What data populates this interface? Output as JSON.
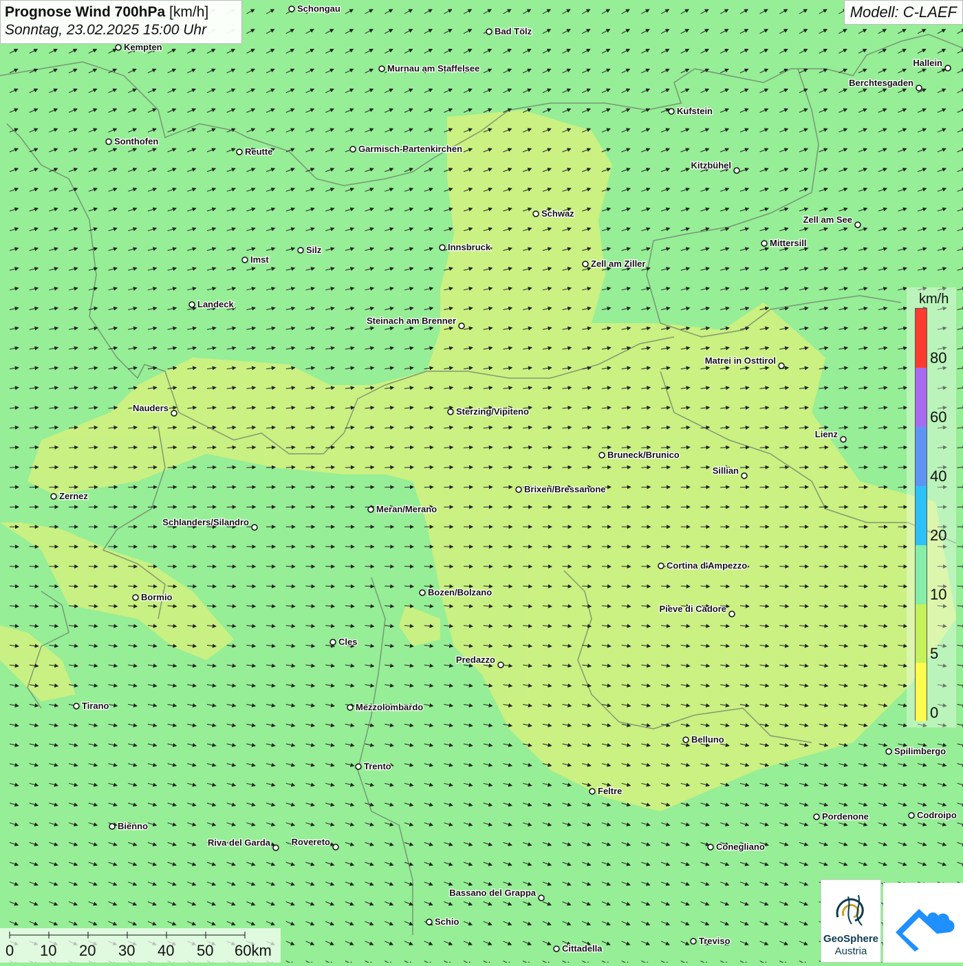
{
  "title": {
    "bold": "Prognose Wind 700hPa",
    "unit": "[km/h]",
    "date": "Sonntag, 23.02.2025 15:00 Uhr"
  },
  "model": "Modell: C-LAEF",
  "legend": {
    "unit": "km/h",
    "labels": [
      "80",
      "60",
      "40",
      "20",
      "10",
      "5",
      "0"
    ],
    "colors": [
      "#ff3b30",
      "#a86bf0",
      "#5e95f5",
      "#2ec1f7",
      "#86eea8",
      "#c5f15b",
      "#fffb4f"
    ]
  },
  "scale": {
    "labels": [
      "0",
      "10",
      "20",
      "30",
      "40",
      "50",
      "60km"
    ]
  },
  "logos": {
    "geosphere_line1": "GeoSphere",
    "geosphere_line2": "Austria"
  },
  "cities": [
    "Schongau",
    "Bad Tölz",
    "Kempten",
    "Murnau am Staffelsee",
    "Hallein",
    "Berchtesgaden",
    "Kufstein",
    "Sonthofen",
    "Reutte",
    "Garmisch-Partenkirchen",
    "Kitzbühel",
    "Schwaz",
    "Zell am See",
    "Innsbruck",
    "Mittersill",
    "Silz",
    "Imst",
    "Zell am Ziller",
    "Landeck",
    "Steinach am Brenner",
    "Matrei in Osttirol",
    "Nauders",
    "Sterzing/Vipiteno",
    "Lienz",
    "Bruneck/Brunico",
    "Sillian",
    "Zernez",
    "Brixen/Bressanone",
    "Meran/Merano",
    "Schlanders/Silandro",
    "Cortina d'Ampezzo",
    "Bozen/Bolzano",
    "Bormio",
    "Pieve di Cadore",
    "Cles",
    "Predazzo",
    "Tirano",
    "Mezzolombardo",
    "Belluno",
    "Spilimbergo",
    "Trento",
    "Feltre",
    "Bienno",
    "Pordenone",
    "Codroipo",
    "Riva del Garda",
    "Rovereto",
    "Conegliano",
    "Bassano del Grappa",
    "Schio",
    "Treviso",
    "Cittadella"
  ]
}
